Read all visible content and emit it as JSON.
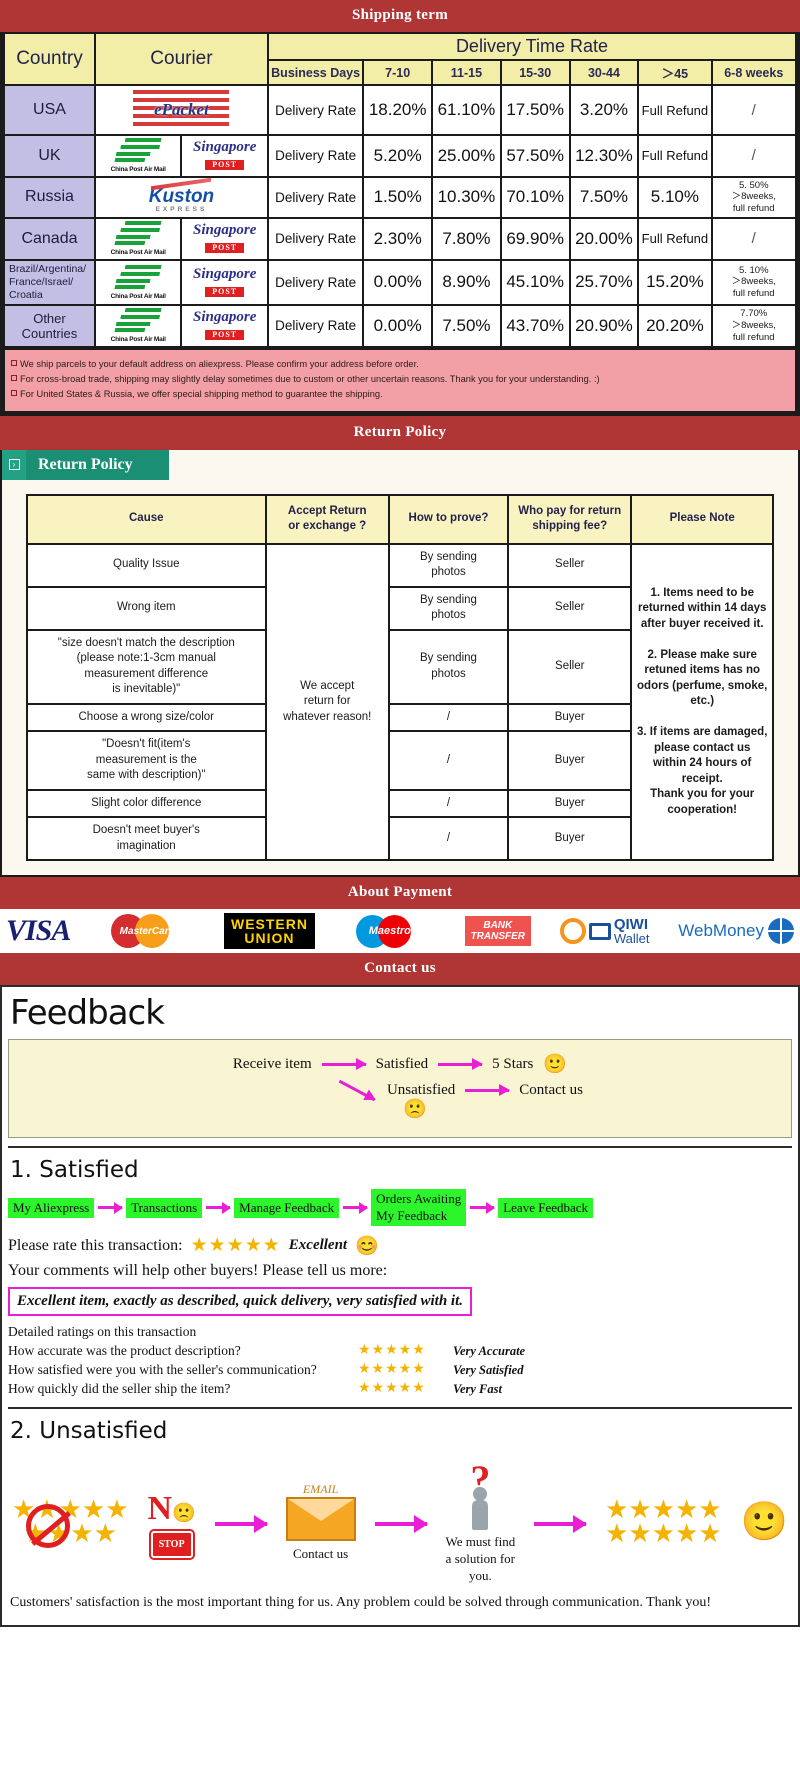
{
  "banners": {
    "shipping": "Shipping term",
    "return": "Return Policy",
    "payment": "About Payment",
    "contact": "Contact us"
  },
  "shipping": {
    "headers": {
      "country": "Country",
      "courier": "Courier",
      "delivery_time_rate": "Delivery Time Rate",
      "business_days": "Business Days",
      "ranges": [
        "7-10",
        "11-15",
        "15-30",
        "30-44",
        "＞45",
        "6-8 weeks"
      ]
    },
    "rate_label": "Delivery Rate",
    "rows": [
      {
        "country": "USA",
        "couriers": [
          "epacket"
        ],
        "values": [
          "18.20%",
          "61.10%",
          "17.50%",
          "3.20%",
          "Full Refund",
          "/"
        ]
      },
      {
        "country": "UK",
        "couriers": [
          "china-post-air-mail",
          "singapore-post"
        ],
        "values": [
          "5.20%",
          "25.00%",
          "57.50%",
          "12.30%",
          "Full Refund",
          "/"
        ]
      },
      {
        "country": "Russia",
        "couriers": [
          "kuston-express"
        ],
        "values": [
          "1.50%",
          "10.30%",
          "70.10%",
          "7.50%",
          "5.10%",
          "5. 50%\n＞8weeks,\nfull refund"
        ]
      },
      {
        "country": "Canada",
        "couriers": [
          "china-post-air-mail",
          "singapore-post"
        ],
        "values": [
          "2.30%",
          "7.80%",
          "69.90%",
          "20.00%",
          "Full Refund",
          "/"
        ]
      },
      {
        "country": "Brazil/Argentina/\nFrance/Israel/\nCroatia",
        "couriers": [
          "china-post-air-mail",
          "singapore-post"
        ],
        "values": [
          "0.00%",
          "8.90%",
          "45.10%",
          "25.70%",
          "15.20%",
          "5. 10%\n＞8weeks,\nfull refund"
        ]
      },
      {
        "country": "Other Countries",
        "couriers": [
          "china-post-air-mail",
          "singapore-post"
        ],
        "values": [
          "0.00%",
          "7.50%",
          "43.70%",
          "20.90%",
          "20.20%",
          "7.70%\n＞8weeks,\nfull refund"
        ]
      }
    ],
    "notes": [
      "We ship parcels to your default address on aliexpress. Please confirm your address before order.",
      "For cross-broad trade, shipping may slightly delay sometimes due to custom or other uncertain reasons. Thank you for your understanding. :)",
      "For United States & Russia, we offer special shipping method to guarantee the shipping."
    ],
    "logos": {
      "epacket": "ePacket",
      "china_post": "China Post Air Mail",
      "singapore_post_name": "Singapore",
      "singapore_post_tag": "POST",
      "kuston": "Kuston",
      "kuston_sub": "EXPRESS"
    }
  },
  "return_policy": {
    "tab_label": "Return Policy",
    "columns": [
      "Cause",
      "Accept Return\nor exchange ?",
      "How to prove?",
      "Who pay for return\nshipping fee?",
      "Please Note"
    ],
    "accept_text": "We accept\nreturn for\nwhatever reason!",
    "note_text": "1. Items need to be returned within 14 days after buyer received it.\n\n2. Please make sure retuned items has no odors (perfume, smoke, etc.)\n\n3. If items are damaged, please contact us within 24 hours of receipt.\nThank you for your cooperation!",
    "rows": [
      {
        "cause": "Quality Issue",
        "prove": "By sending\nphotos",
        "who": "Seller"
      },
      {
        "cause": "Wrong item",
        "prove": "By sending\nphotos",
        "who": "Seller"
      },
      {
        "cause": "\"size doesn't match the description\n(please note:1-3cm manual\nmeasurement difference\nis inevitable)\"",
        "prove": "By sending\nphotos",
        "who": "Seller"
      },
      {
        "cause": "Choose a wrong size/color",
        "prove": "/",
        "who": "Buyer"
      },
      {
        "cause": "\"Doesn't fit(item's\nmeasurement is the\nsame with description)\"",
        "prove": "/",
        "who": "Buyer"
      },
      {
        "cause": "Slight color difference",
        "prove": "/",
        "who": "Buyer"
      },
      {
        "cause": "Doesn't meet buyer's\nimagination",
        "prove": "/",
        "who": "Buyer"
      }
    ]
  },
  "payment": {
    "methods": [
      "VISA",
      "MasterCard",
      "WESTERN UNION",
      "Maestro",
      "BANK TRANSFER",
      "QIWI Wallet",
      "WebMoney"
    ],
    "visa": "VISA",
    "mastercard": "MasterCard",
    "western": "WESTERN",
    "union": "UNION",
    "maestro": "Maestro",
    "bank": "BANK",
    "transfer": "TRANSFER",
    "qiwi": "QIWI",
    "wallet": "Wallet",
    "webmoney": "WebMoney"
  },
  "feedback": {
    "title": "Feedback",
    "flow": {
      "receive": "Receive item",
      "satisfied": "Satisfied",
      "five_stars": "5 Stars",
      "unsatisfied": "Unsatisfied",
      "contact": "Contact us",
      "happy_face": "🙂",
      "sad_face": "🙁"
    },
    "satisfied": {
      "heading": "1. Satisfied",
      "steps": [
        "My Aliexpress",
        "Transactions",
        "Manage Feedback",
        "Orders Awaiting\nMy Feedback",
        "Leave Feedback"
      ],
      "rate_label": "Please rate this transaction:",
      "stars": "★★★★★",
      "excellent": "Excellent",
      "smiley": "😊",
      "tell_more": "Your comments will help other buyers! Please tell us more:",
      "quote": "Excellent item, exactly as described, quick delivery, very satisfied with it.",
      "detail_head": "Detailed ratings on this transaction",
      "details": [
        {
          "question": "How accurate was the product description?",
          "stars": "★★★★★",
          "verdict": "Very Accurate"
        },
        {
          "question": "How satisfied were you with the seller's communication?",
          "stars": "★★★★★",
          "verdict": "Very Satisfied"
        },
        {
          "question": "How quickly did the seller ship the item?",
          "stars": "★★★★★",
          "verdict": "Very Fast"
        }
      ]
    },
    "unsatisfied": {
      "heading": "2. Unsatisfied",
      "no_label": "N",
      "stop_label": "STOP",
      "email_label": "EMAIL",
      "contact_us": "Contact us",
      "solution": "We must find\na solution for\nyou.",
      "closing": "Customers' satisfaction is the most important thing for us. Any problem could be solved through communication. Thank you!"
    }
  },
  "colors": {
    "banner_red": "#b03636",
    "header_yellow": "#f2eea8",
    "country_purple": "#c3bfe4",
    "note_pink": "#f2a0a6",
    "tab_green": "#1a8f73",
    "step_green": "#2cf52c",
    "arrow_magenta": "#e81fd4",
    "star_gold": "#f5b301"
  }
}
